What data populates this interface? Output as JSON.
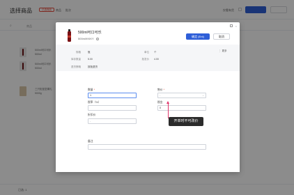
{
  "background": {
    "title": "选择商品",
    "tag": "已选商品",
    "nav": [
      "商品",
      "批次"
    ],
    "right_label": "仅看有货",
    "search_icon": "search-icon",
    "search_text": "商品",
    "items": [
      {
        "line1": "500ml可口可乐",
        "line2": "500ml"
      },
      {
        "line1": "500ml可口可乐",
        "line2": "500ml"
      },
      {
        "line1": "三只松鼠坚果礼",
        "line2": "5000g"
      }
    ],
    "footer_text": "已选: 1"
  },
  "modal": {
    "product_name": "500ml可口可乐",
    "product_code": "500ml/KKKY",
    "info_icon": "info-icon",
    "confirm_label": "确定 (Ent)",
    "cancel_label": "取消",
    "info": {
      "spec_label": "规格",
      "spec_value": "瓶",
      "unit_label": "单位",
      "unit_value": "个",
      "stock_label": "库存数量",
      "stock_value": "5.00",
      "price_label": "批发价",
      "price_value": "4.00",
      "more_label": "更多",
      "return_label": "退货策略",
      "return_value": "按批退货"
    },
    "form": {
      "quantity_label": "数量",
      "quantity_value": "1",
      "price_label": "售价",
      "price_placeholder": "-",
      "tax_label": "税率（%）",
      "tax_value": "",
      "tax_amount_label": "税金",
      "tax_amount_value": "0",
      "discount_label": "折扣价",
      "discount_placeholder": "-",
      "remark_label": "备注",
      "remark_value": ""
    },
    "tooltip": "开单时不可改价",
    "colors": {
      "primary": "#2f5fd8",
      "annotation": "#e0356b",
      "product": "#7a1014"
    }
  }
}
